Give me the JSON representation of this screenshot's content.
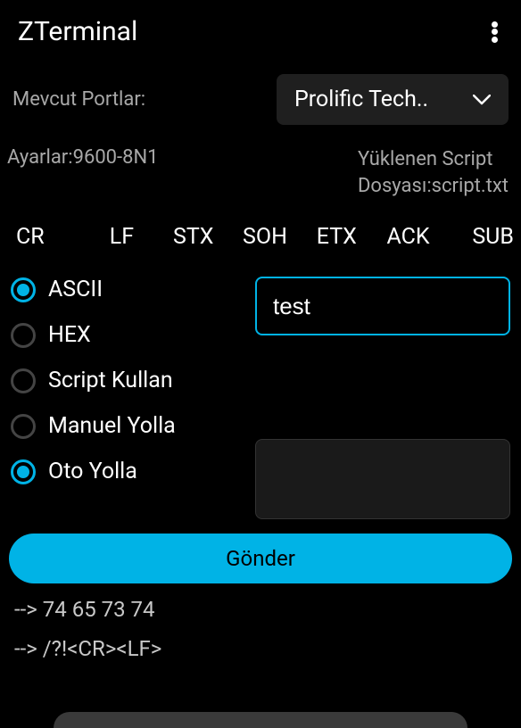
{
  "header": {
    "title": "ZTerminal"
  },
  "ports": {
    "label": "Mevcut Portlar:",
    "selected": "Prolific Tech.."
  },
  "settings": {
    "line": "Ayarlar:9600-8N1",
    "script_line1": "Yüklenen Script",
    "script_line2": "Dosyası:script.txt"
  },
  "ctrl": [
    "CR",
    "LF",
    "STX",
    "SOH",
    "ETX",
    "ACK",
    "SUB"
  ],
  "modes": {
    "ascii": "ASCII",
    "hex": "HEX",
    "script": "Script Kullan",
    "manual": "Manuel Yolla",
    "auto": "Oto Yolla"
  },
  "input": {
    "value": "test"
  },
  "textarea": {
    "value": ""
  },
  "send": "Gönder",
  "log": {
    "l1": "--> 74 65 73 74",
    "l2": "--> /?!<CR><LF>"
  }
}
